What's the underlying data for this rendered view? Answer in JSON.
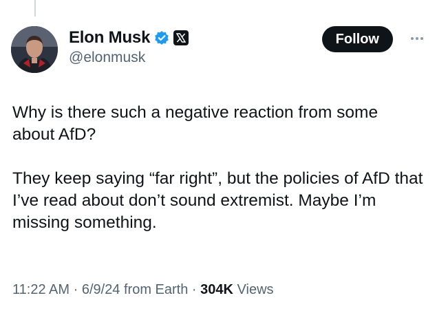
{
  "author": {
    "name": "Elon Musk",
    "handle": "@elonmusk",
    "verified": true,
    "affiliation_badge": "x-logo-icon"
  },
  "actions": {
    "follow_label": "Follow",
    "more_icon": "more-horizontal-icon"
  },
  "tweet": {
    "paragraphs": [
      "Why is there such a negative reaction from some about AfD?",
      "They keep saying “far right”, but the policies of AfD that I’ve read about don’t sound extremist. Maybe I’m missing something."
    ]
  },
  "meta": {
    "time": "11:22 AM",
    "separator": "·",
    "date": "6/9/24",
    "source": "from Earth",
    "views_count": "304K",
    "views_label": "Views"
  },
  "colors": {
    "text_primary": "#0f1419",
    "text_secondary": "#536471",
    "verified_blue": "#1d9bf0",
    "follow_bg": "#0f1419"
  }
}
